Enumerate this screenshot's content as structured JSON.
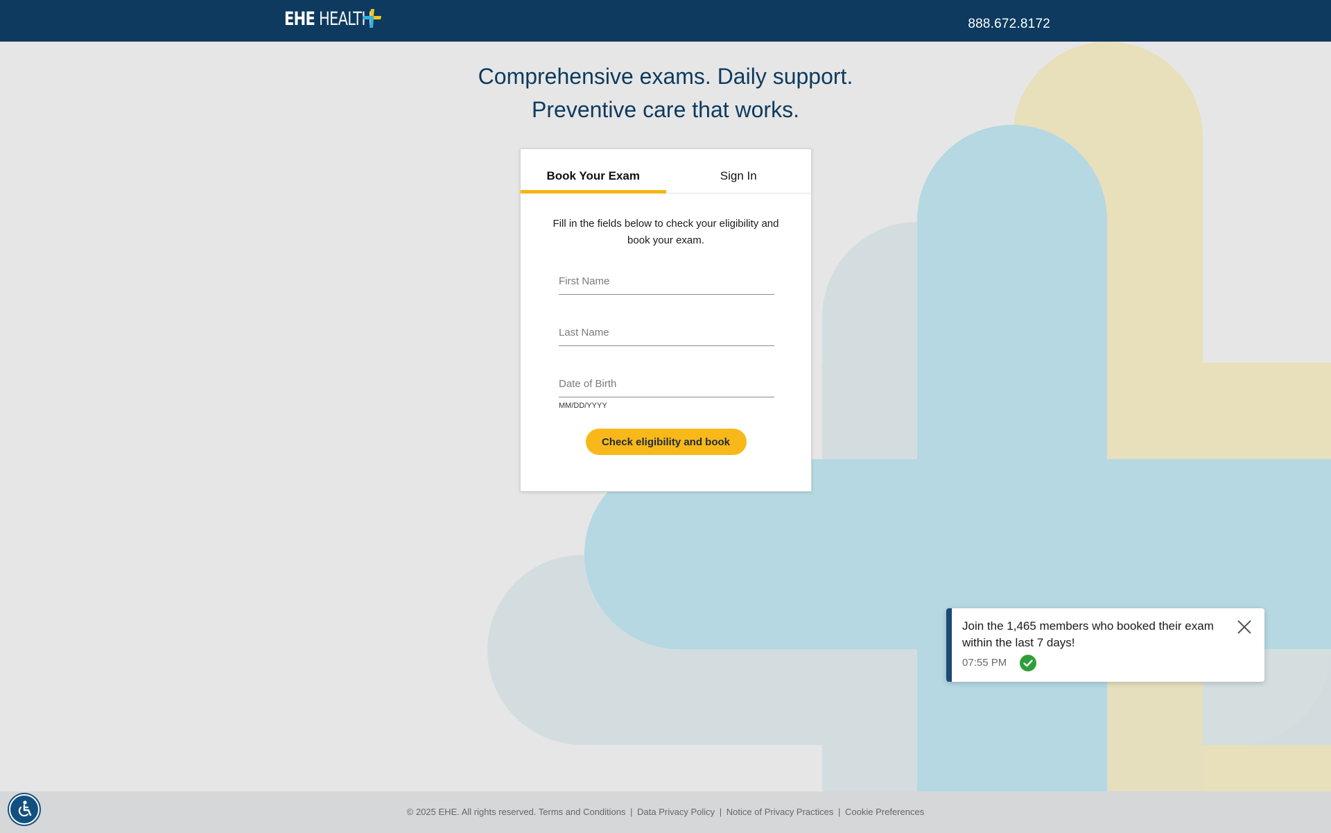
{
  "header": {
    "logo_part1": "EHE",
    "logo_part2": "HEALTH",
    "phone": "888.672.8172"
  },
  "headline": {
    "line1": "Comprehensive exams. Daily support.",
    "line2": "Preventive care that works."
  },
  "card": {
    "tabs": [
      {
        "label": "Book Your Exam",
        "active": true
      },
      {
        "label": "Sign In",
        "active": false
      }
    ],
    "intro": "Fill in the fields below to check your eligibility and book your exam.",
    "fields": {
      "first_name": {
        "value": "",
        "placeholder": "First Name"
      },
      "last_name": {
        "value": "",
        "placeholder": "Last Name"
      },
      "dob": {
        "value": "",
        "placeholder": "Date of Birth",
        "hint": "MM/DD/YYYY"
      }
    },
    "cta_label": "Check eligibility and book"
  },
  "toast": {
    "message": "Join the 1,465 members who booked their exam within the last 7 days!",
    "time": "07:55 PM"
  },
  "footer": {
    "copyright": "© 2025 EHE. All rights reserved.",
    "links": [
      "Terms and Conditions",
      "Data Privacy Policy",
      "Notice of Privacy Practices",
      "Cookie Preferences"
    ],
    "separator": "|"
  },
  "icons": {
    "logo": "plus-logo-icon",
    "toast_close": "close-icon",
    "toast_status": "check-circle-icon",
    "accessibility": "accessibility-icon"
  },
  "colors": {
    "header_bg": "#0d3a5e",
    "accent_yellow": "#f5b512",
    "shape_blue": "#b5d8e2",
    "shape_gray": "#d3dde0",
    "shape_tan": "#e8dfbb",
    "success_green": "#2e9e3a"
  }
}
